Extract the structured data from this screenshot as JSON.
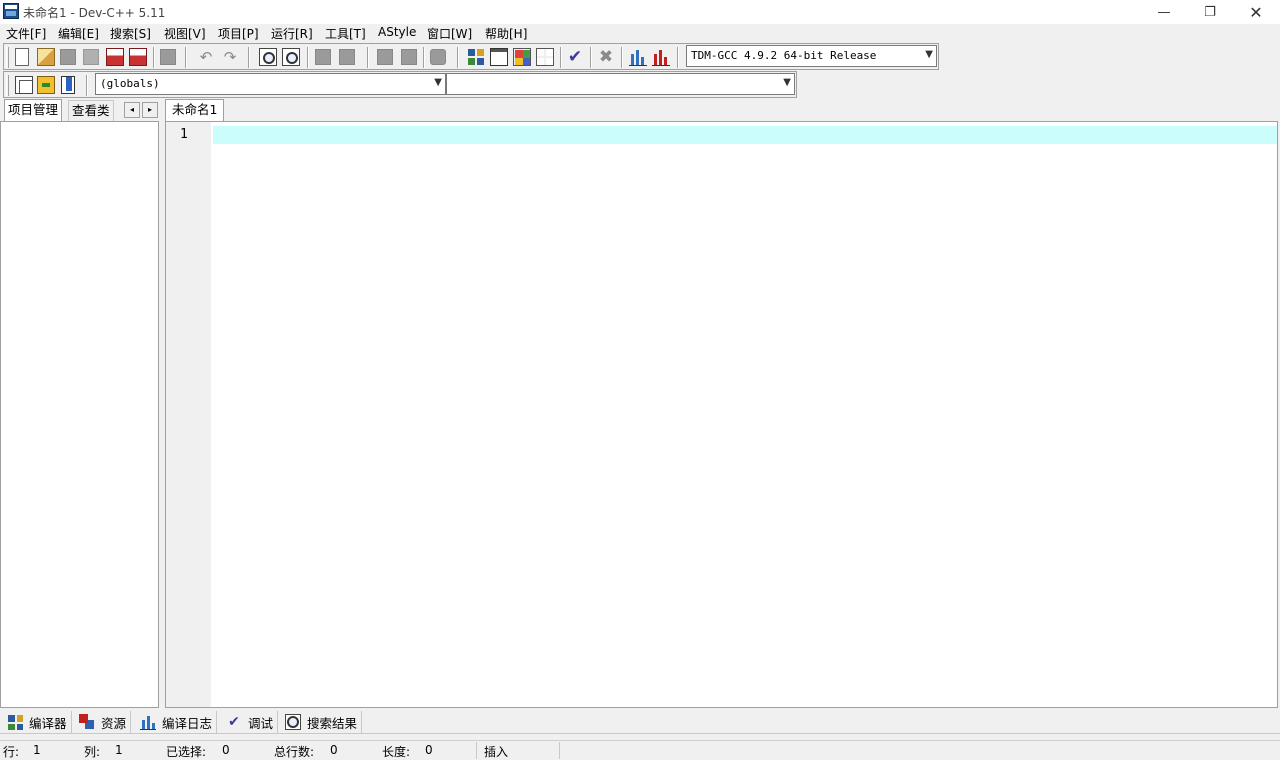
{
  "window": {
    "title": "未命名1 - Dev-C++ 5.11",
    "minimize": "—",
    "maximize": "❐",
    "close": "✕"
  },
  "menu": [
    "文件[F]",
    "编辑[E]",
    "搜索[S]",
    "视图[V]",
    "项目[P]",
    "运行[R]",
    "工具[T]",
    "AStyle",
    "窗口[W]",
    "帮助[H]"
  ],
  "toolbar": {
    "compiler_select": "TDM-GCC 4.9.2 64-bit Release",
    "scope_select": "(globals)",
    "member_select": ""
  },
  "left_panel": {
    "tabs": [
      "项目管理",
      "查看类"
    ],
    "active_tab": "项目管理",
    "scroll_left": "◂",
    "scroll_right": "▸"
  },
  "editor": {
    "tab_label": "未命名1",
    "line_numbers": [
      "1"
    ],
    "active_line_color": "#ccfdfd"
  },
  "bottom_tabs": [
    "编译器",
    "资源",
    "编译日志",
    "调试",
    "搜索结果"
  ],
  "status": {
    "row_label": "行:",
    "row_value": "1",
    "col_label": "列:",
    "col_value": "1",
    "selected_label": "已选择:",
    "selected_value": "0",
    "total_lines_label": "总行数:",
    "total_lines_value": "0",
    "length_label": "长度:",
    "length_value": "0",
    "mode": "插入"
  },
  "icons": [
    "new-file-icon",
    "open-icon",
    "save-icon",
    "save-all-icon",
    "close-icon",
    "close-all-icon",
    "print-icon",
    "undo-icon",
    "redo-icon",
    "find-icon",
    "replace-icon",
    "indent-icon",
    "unindent-icon",
    "bookmark-prev-icon",
    "bookmark-next-icon",
    "toggle-comment-icon",
    "compile-icon",
    "run-icon",
    "compile-run-icon",
    "rebuild-icon",
    "check-syntax-icon",
    "stop-icon",
    "profile-icon",
    "delete-profile-icon",
    "new-class-icon",
    "insert-icon",
    "toggle-bookmark-icon"
  ]
}
